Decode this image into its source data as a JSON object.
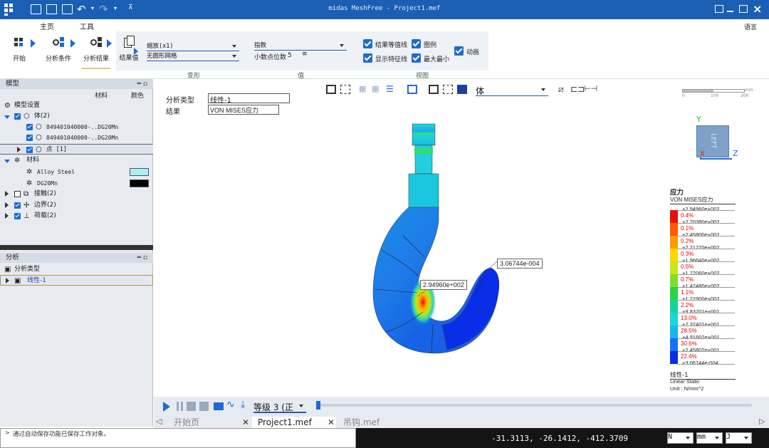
{
  "app": {
    "title": "midas MeshFree - Project1.mef"
  },
  "menu": {
    "tabs": [
      "主页",
      "工具"
    ],
    "language": "语言"
  },
  "ribbon": {
    "buttons": {
      "start": "开始",
      "analysis_conditions": "分析条件",
      "analysis_results": "分析结果",
      "results": "结果值"
    },
    "deform_scale": "缩放(x1)",
    "undeformed": "无圆形网格",
    "value_format": "指数",
    "decimal_label": "小数点位数",
    "decimal_value": "5",
    "checks": {
      "contour": "结果等值线",
      "show_feature": "显示特征线",
      "legend": "图例",
      "maxmin": "最大最小",
      "animate": "动画"
    },
    "groups": {
      "deform": "变形",
      "value": "值",
      "view": "视图"
    }
  },
  "model_panel": {
    "title": "模型",
    "col_material": "材料",
    "col_color": "颜色",
    "settings": "模型设置",
    "bodies": "体(2)",
    "body1": "849401040000-..DG20Mn",
    "body2": "849401040000-..DG20Mn",
    "points": "点 [1]",
    "materials": "材料",
    "mat1": "Alloy Steel",
    "mat2": "DG20Mn",
    "contacts": "接触(2)",
    "boundaries": "边界(2)",
    "loads": "荷载(2)",
    "mat1_color": "#a9f0f7",
    "mat2_color": "#000000"
  },
  "analysis_panel": {
    "title": "分析",
    "type": "分析类型",
    "case": "线性-1"
  },
  "viewport": {
    "type_label": "分析类型",
    "type_value": "线性-1",
    "result_label": "结果",
    "result_value": "VON MISES应力",
    "display_mode": "体",
    "scale_labels": [
      "0",
      "100",
      "200"
    ],
    "scale_unit": "mm",
    "max_label": "2.94960e+002",
    "min_label": "3.06744e-004",
    "view_cube": "LEFT",
    "axis_y": "Y",
    "axis_z": "Z",
    "axis_x": "X"
  },
  "legend": {
    "title": "应力",
    "subtitle": "VON MISES应力",
    "values": [
      "+2.94960e+002",
      "+2.70380e+002",
      "+2.45800e+002",
      "+2.21220e+002",
      "+1.96640e+002",
      "+1.72060e+002",
      "+1.47480e+002",
      "+1.22900e+002",
      "+9.83201e+001",
      "+7.37401e+001",
      "+4.91602e+001",
      "+2.45802e+001",
      "+3.06744e-004"
    ],
    "percents": [
      "0.4%",
      "0.1%",
      "0.2%",
      "0.3%",
      "0.5%",
      "0.7%",
      "1.1%",
      "2.2%",
      "13.0%",
      "28.5%",
      "30.6%",
      "22.4%"
    ],
    "colors": [
      "#e8100a",
      "#ff5a00",
      "#ff9b00",
      "#ffd700",
      "#c8e81a",
      "#7ee02a",
      "#2bd24a",
      "#14d49a",
      "#18d8d8",
      "#19b6f0",
      "#1673f0",
      "#0a2ee8"
    ],
    "case": "线性-1",
    "analysis": "Linear Static",
    "unit": "Unit : N/mm^2"
  },
  "bottom_toolbar": {
    "level": "等级 3 (正"
  },
  "doc_tabs": [
    "开始页",
    "Project1.mef",
    "吊钩.mef"
  ],
  "status": {
    "message": "通过自动保存功能已保存工作对象。",
    "coords": "-31.3113,  -26.1412,  -412.3709",
    "unit_force": "N",
    "unit_length": "mm",
    "unit_energy": "J"
  }
}
